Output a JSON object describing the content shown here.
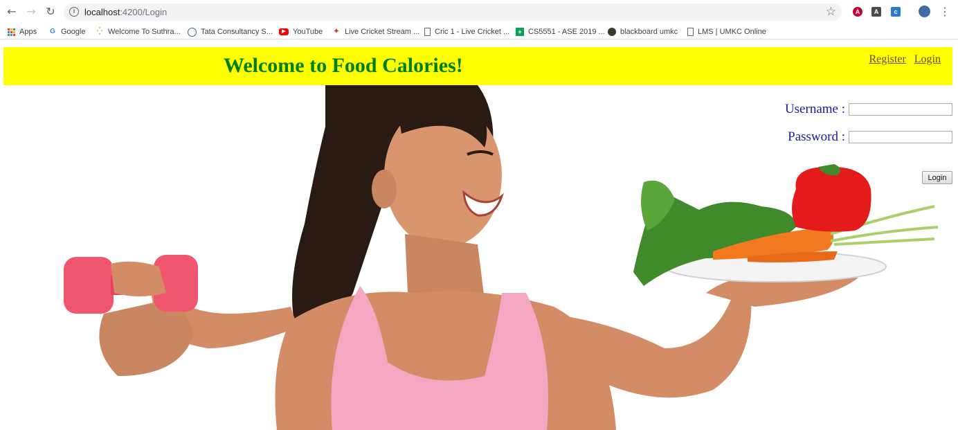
{
  "browser": {
    "url_host": "localhost",
    "url_path": ":4200/Login",
    "bookmarks": [
      {
        "label": "Apps",
        "icon": "apps-grid-icon"
      },
      {
        "label": "Google",
        "icon": "google-icon"
      },
      {
        "label": "Welcome To Suthra...",
        "icon": "loading-icon"
      },
      {
        "label": "Tata Consultancy S...",
        "icon": "tcs-icon"
      },
      {
        "label": "YouTube",
        "icon": "youtube-icon"
      },
      {
        "label": "Live Cricket Stream ...",
        "icon": "cricket-icon"
      },
      {
        "label": "Cric 1 - Live Cricket ...",
        "icon": "page-icon"
      },
      {
        "label": "CS5551 - ASE 2019 ...",
        "icon": "sheets-icon"
      },
      {
        "label": "blackboard umkc",
        "icon": "blackboard-icon"
      },
      {
        "label": "LMS | UMKC Online",
        "icon": "page-icon"
      }
    ]
  },
  "header": {
    "title": "Welcome to Food Calories!",
    "register_label": "Register",
    "login_label": "Login",
    "bg_color": "#ffff00",
    "title_color": "#008000"
  },
  "form": {
    "username_label": "Username :",
    "password_label": "Password :",
    "username_value": "",
    "password_value": "",
    "submit_label": "Login"
  }
}
